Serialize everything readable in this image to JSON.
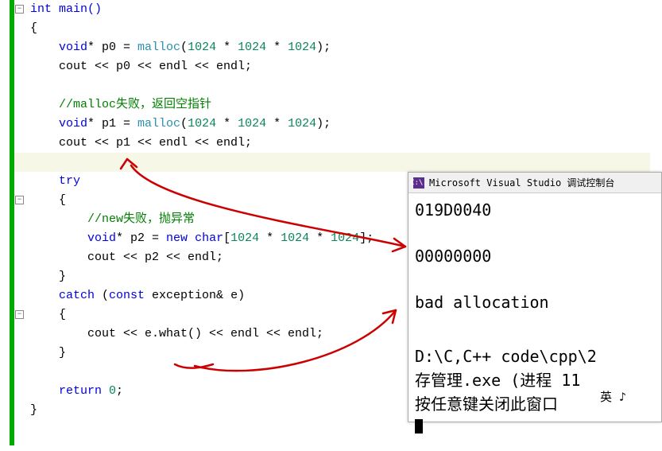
{
  "code": {
    "l1": "int main()",
    "l2": "{",
    "l3_1": "    void",
    "l3_2": "* p0 = ",
    "l3_3": "malloc",
    "l3_4": "(",
    "l3_5": "1024",
    "l3_6": " * ",
    "l3_7": "1024",
    "l3_8": " * ",
    "l3_9": "1024",
    "l3_10": ");",
    "l4_1": "    cout << p0 << endl << endl;",
    "l5": "",
    "l6": "    //malloc失败，返回空指针",
    "l7_1": "    void",
    "l7_2": "* p1 = ",
    "l7_3": "malloc",
    "l7_4": "(",
    "l7_5": "1024",
    "l7_6": " * ",
    "l7_7": "1024",
    "l7_8": " * ",
    "l7_9": "1024",
    "l7_10": ");",
    "l8": "    cout << p1 << endl << endl;",
    "l9": "",
    "l10_1": "    try",
    "l11": "    {",
    "l12": "        //new失败，抛异常",
    "l13_1": "        void",
    "l13_2": "* p2 = ",
    "l13_3": "new",
    "l13_4": " ",
    "l13_5": "char",
    "l13_6": "[",
    "l13_7": "1024",
    "l13_8": " * ",
    "l13_9": "1024",
    "l13_10": " * ",
    "l13_11": "1024",
    "l13_12": "];",
    "l14": "        cout << p2 << endl;",
    "l15": "    }",
    "l16_1": "    catch",
    "l16_2": " (",
    "l16_3": "const",
    "l16_4": " exception& e)",
    "l17": "    {",
    "l18": "        cout << e.what() << endl << endl;",
    "l19": "    }",
    "l20": "",
    "l21_1": "    return",
    "l21_2": " ",
    "l21_3": "0",
    "l21_4": ";",
    "l22": "}"
  },
  "console": {
    "icon_text": "C:\\.",
    "title": "Microsoft Visual Studio 调试控制台",
    "out1": "019D0040",
    "out2": "00000000",
    "out3": "bad allocation",
    "out4": "D:\\C,C++ code\\cpp\\2",
    "out5": "存管理.exe (进程 11",
    "out6": "按任意键关闭此窗口",
    "ime": "英 ♪ "
  },
  "fold": {
    "minus": "−"
  }
}
